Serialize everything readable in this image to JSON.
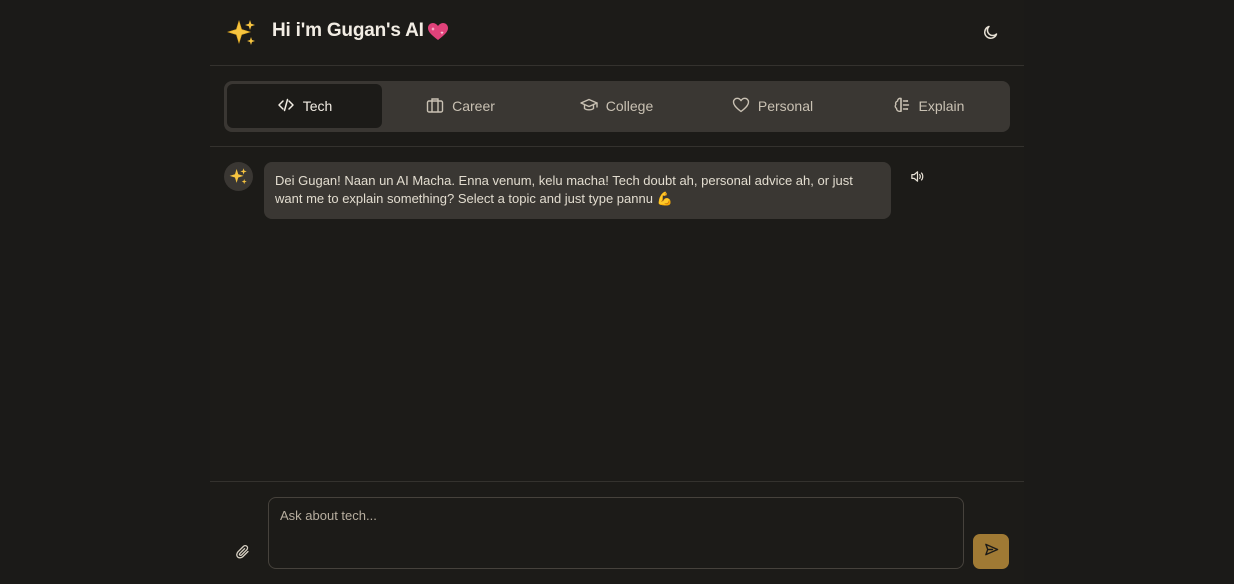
{
  "header": {
    "title": "Hi i'm Gugan's AI",
    "sparkle_icon": "sparkles-icon",
    "heart_icon": "sparkling-heart-icon",
    "theme_toggle_icon": "moon-icon"
  },
  "tabs": [
    {
      "label": "Tech",
      "icon": "code-icon",
      "active": true
    },
    {
      "label": "Career",
      "icon": "briefcase-icon",
      "active": false
    },
    {
      "label": "College",
      "icon": "graduation-cap-icon",
      "active": false
    },
    {
      "label": "Personal",
      "icon": "heart-icon",
      "active": false
    },
    {
      "label": "Explain",
      "icon": "brain-icon",
      "active": false
    }
  ],
  "messages": [
    {
      "role": "assistant",
      "text": "Dei Gugan! Naan un AI Macha. Enna venum, kelu macha! Tech doubt ah, personal advice ah, or just want me to explain something? Select a topic and just type pannu 💪",
      "speaker_icon": "volume-icon"
    }
  ],
  "composer": {
    "placeholder": "Ask about tech...",
    "value": "",
    "attach_icon": "paperclip-icon",
    "send_icon": "send-icon"
  },
  "colors": {
    "background": "#1b1a18",
    "panel": "#3a3733",
    "accent": "#a07a34",
    "text": "#f2ede4"
  }
}
